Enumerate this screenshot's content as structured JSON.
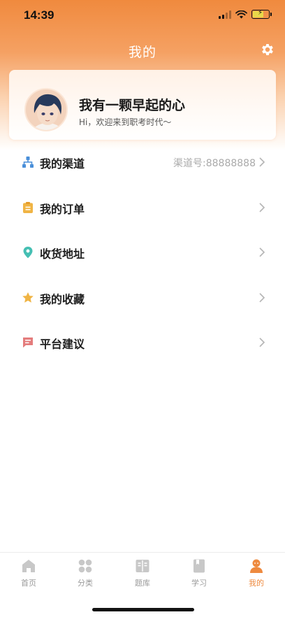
{
  "status_bar": {
    "time": "14:39"
  },
  "header": {
    "title": "我的"
  },
  "profile": {
    "name": "我有一颗早起的心",
    "greeting": "Hi，欢迎来到职考时代～"
  },
  "menu": {
    "items": [
      {
        "label": "我的渠道",
        "value": "渠道号:88888888",
        "icon": "channel-icon",
        "color": "#4a8fd9"
      },
      {
        "label": "我的订单",
        "value": "",
        "icon": "order-icon",
        "color": "#f0b444"
      },
      {
        "label": "收货地址",
        "value": "",
        "icon": "location-icon",
        "color": "#45bfb3"
      },
      {
        "label": "我的收藏",
        "value": "",
        "icon": "star-icon",
        "color": "#f0b444"
      },
      {
        "label": "平台建议",
        "value": "",
        "icon": "feedback-icon",
        "color": "#e47c7c"
      }
    ]
  },
  "tab_bar": {
    "tabs": [
      {
        "label": "首页",
        "icon": "home-icon",
        "active": false
      },
      {
        "label": "分类",
        "icon": "category-icon",
        "active": false
      },
      {
        "label": "题库",
        "icon": "question-bank-icon",
        "active": false
      },
      {
        "label": "学习",
        "icon": "study-icon",
        "active": false
      },
      {
        "label": "我的",
        "icon": "profile-icon",
        "active": true
      }
    ]
  },
  "colors": {
    "accent": "#ee8a3f",
    "header_start": "#f08a3e",
    "inactive": "#9a9a9a"
  }
}
